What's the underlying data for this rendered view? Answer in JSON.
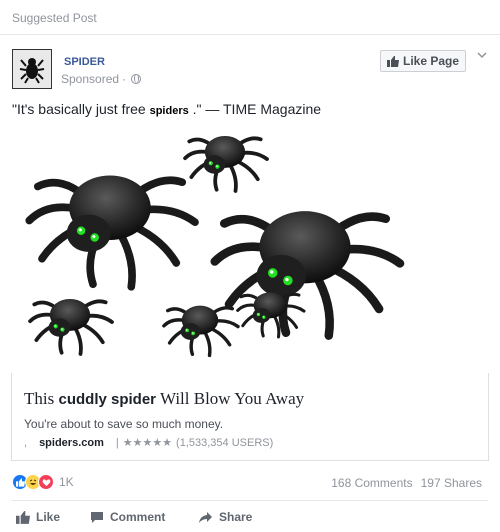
{
  "header": {
    "suggested_label": "Suggested Post"
  },
  "page": {
    "name": "SPIDER",
    "sponsored": "Sponsored",
    "dot": "·",
    "like_button": "Like Page"
  },
  "post": {
    "text_before": "\"It's basically just free ",
    "text_emph": "spiders",
    "text_after": " .\" — TIME Magazine"
  },
  "link": {
    "title_prefix": "This ",
    "title_bold": "cuddly spider",
    "title_suffix": "  Will Blow You Away",
    "description": "You're about to save so much money.",
    "bullet": ",",
    "domain": "spiders.com",
    "separator": "|",
    "stars": "★★★★★",
    "users": "(1,533,354 USERS)"
  },
  "reactions": {
    "count": "1K",
    "comments": "168 Comments",
    "shares": "197 Shares"
  },
  "actions": {
    "like": "Like",
    "comment": "Comment",
    "share": "Share"
  },
  "colors": {
    "link_blue": "#3b5998",
    "like_blue": "#1877f2",
    "love_red": "#f33e58",
    "haha_yellow": "#fcd34d",
    "spider_eye_green": "#22e022"
  }
}
